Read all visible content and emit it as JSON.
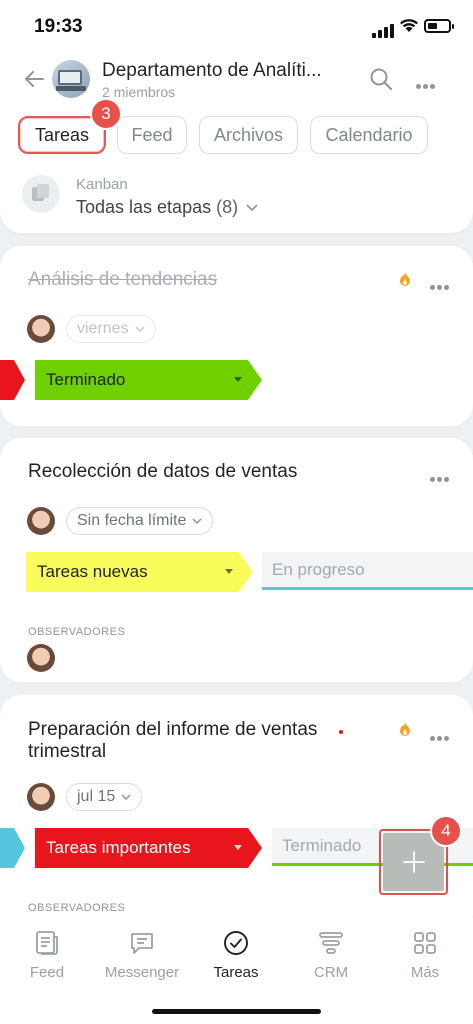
{
  "status": {
    "time": "19:33"
  },
  "header": {
    "group_title": "Departamento de Analíti...",
    "members": "2 miembros",
    "tabs": [
      {
        "label": "Tareas"
      },
      {
        "label": "Feed"
      },
      {
        "label": "Archivos"
      },
      {
        "label": "Calendario"
      }
    ],
    "tab_badge": "3",
    "view_mode": "Kanban",
    "stage_filter": "Todas las etapas",
    "stage_count": "(8)"
  },
  "tasks": [
    {
      "title": "Análisis de tendencias",
      "deadline": "viernes",
      "stage": "Terminado",
      "stage_color": "#6fd000",
      "completed": true
    },
    {
      "title": "Recolección de datos de ventas",
      "deadline": "Sin fecha límite",
      "stage": "Tareas nuevas",
      "stage_color": "#fafc5b",
      "next_stage": "En progreso",
      "next_stage_color": "#55c6dd",
      "observers_label": "OBSERVADORES"
    },
    {
      "title": "Preparación del informe de ventas trimestral",
      "deadline": "jul 15",
      "stage": "Tareas importantes",
      "stage_color": "#e9151d",
      "next_stage": "Terminado",
      "next_stage_color": "#6fd000",
      "observers_label": "OBSERVADORES"
    }
  ],
  "fab_badge": "4",
  "bottom_nav": [
    {
      "label": "Feed"
    },
    {
      "label": "Messenger"
    },
    {
      "label": "Tareas"
    },
    {
      "label": "CRM"
    },
    {
      "label": "Más"
    }
  ]
}
